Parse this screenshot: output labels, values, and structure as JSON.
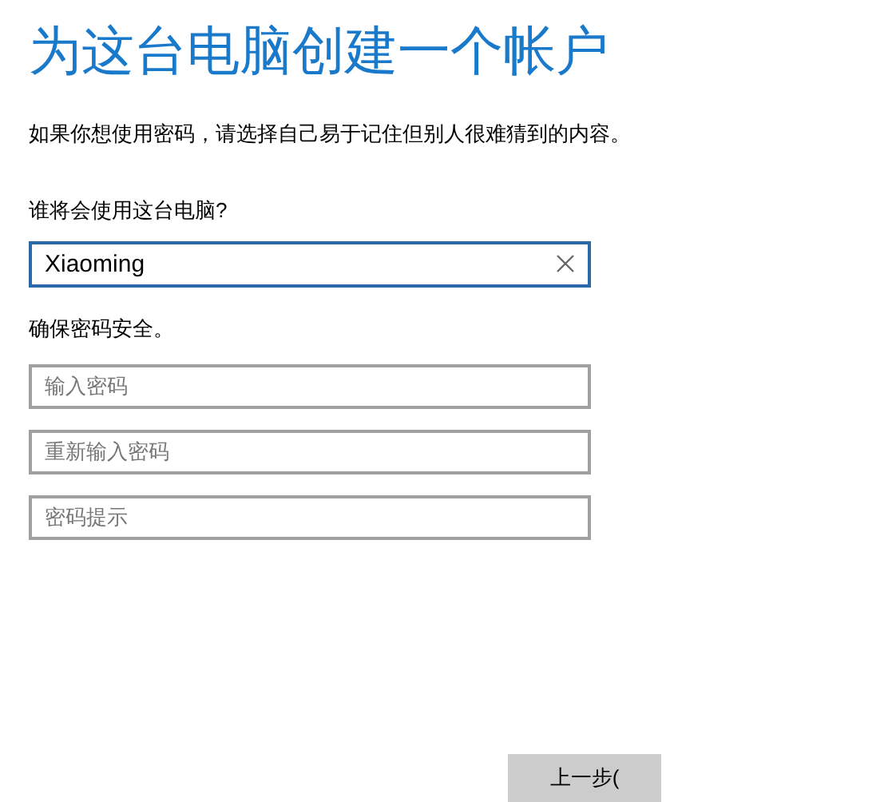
{
  "title": "为这台电脑创建一个帐户",
  "description": "如果你想使用密码，请选择自己易于记住但别人很难猜到的内容。",
  "user_label": "谁将会使用这台电脑?",
  "user_field": {
    "value": "Xiaoming",
    "focused": true
  },
  "password_label": "确保密码安全。",
  "password_fields": [
    {
      "placeholder": "输入密码"
    },
    {
      "placeholder": "重新输入密码"
    },
    {
      "placeholder": "密码提示"
    }
  ],
  "back_button": "上一步("
}
